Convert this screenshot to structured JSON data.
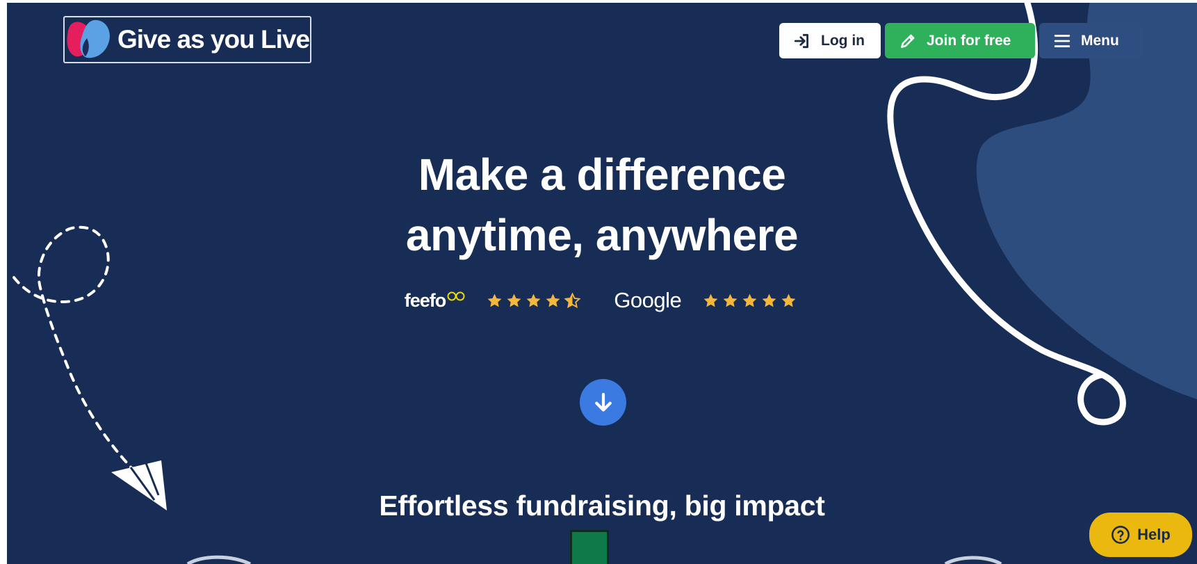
{
  "colors": {
    "page_background": "#172d55",
    "underline_accent": "#36aaa5",
    "join_button": "#2fb15b",
    "menu_button": "#2e4e82",
    "scroll_button": "#3b7ae0",
    "help_button": "#ebb810",
    "star": "#f4b73b"
  },
  "header": {
    "logo_text": "Give as you Live",
    "login_label": "Log in",
    "join_label": "Join for free",
    "menu_label": "Menu",
    "icons": {
      "login": "sign-in-icon",
      "join": "pencil-icon",
      "menu": "hamburger-icon"
    }
  },
  "hero": {
    "title_line1": "Make a difference",
    "title_line2": "anytime, anywhere"
  },
  "ratings": {
    "feefo_label": "feefo",
    "feefo_stars": 4.5,
    "google_label": "Google",
    "google_stars": 5
  },
  "scroll_button": {
    "icon": "arrow-down-icon"
  },
  "section": {
    "title": "Effortless fundraising, big impact"
  },
  "help": {
    "label": "Help",
    "icon": "question-circle-icon"
  }
}
